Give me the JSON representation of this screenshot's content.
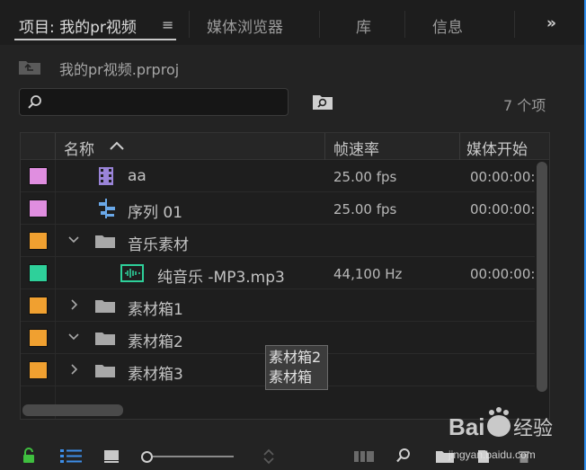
{
  "tabs": [
    {
      "label": "项目: 我的pr视频",
      "active": true
    },
    {
      "label": "媒体浏览器",
      "active": false
    },
    {
      "label": "库",
      "active": false
    },
    {
      "label": "信息",
      "active": false
    }
  ],
  "tab_menu_glyph": "≡",
  "overflow_glyph": "»",
  "project": {
    "file_name": "我的pr视频.prproj"
  },
  "search": {
    "value": "",
    "placeholder": ""
  },
  "item_count": "7 个项",
  "columns": {
    "name": "名称",
    "frame_rate": "帧速率",
    "media_start": "媒体开始"
  },
  "rows": [
    {
      "name": "aa",
      "color": "#e08ee0",
      "icon": "video-clip-icon",
      "expander": "",
      "frame_rate": "25.00 fps",
      "media_start": "00:00:00:"
    },
    {
      "name": "序列 01",
      "color": "#e08ee0",
      "icon": "sequence-icon",
      "expander": "",
      "frame_rate": "25.00 fps",
      "media_start": "00:00:00:"
    },
    {
      "name": "音乐素材",
      "color": "#f0a030",
      "icon": "folder-icon",
      "expander": "expanded",
      "frame_rate": "",
      "media_start": ""
    },
    {
      "name": "纯音乐 -MP3.mp3",
      "color": "#2ed09a",
      "icon": "audio-clip-icon",
      "expander": "",
      "frame_rate": "44,100 Hz",
      "media_start": "00:00:00:"
    },
    {
      "name": "素材箱1",
      "color": "#f0a030",
      "icon": "folder-icon",
      "expander": "collapsed",
      "frame_rate": "",
      "media_start": ""
    },
    {
      "name": "素材箱2",
      "color": "#f0a030",
      "icon": "folder-icon",
      "expander": "expanded",
      "frame_rate": "",
      "media_start": ""
    },
    {
      "name": "素材箱3",
      "color": "#f0a030",
      "icon": "folder-icon",
      "expander": "collapsed",
      "frame_rate": "",
      "media_start": ""
    }
  ],
  "tooltip": {
    "line1": "素材箱2",
    "line2": "素材箱"
  },
  "watermark": {
    "brand": "Bai",
    "brand2": "经验",
    "url": "jingyan.baidu.com"
  },
  "colors": {
    "accent": "#2d8ceb",
    "label_violet": "#e08ee0",
    "label_orange": "#f0a030",
    "label_teal": "#2ed09a",
    "lock_green": "#3fbf3f",
    "list_icon_blue": "#3d8ee8"
  }
}
